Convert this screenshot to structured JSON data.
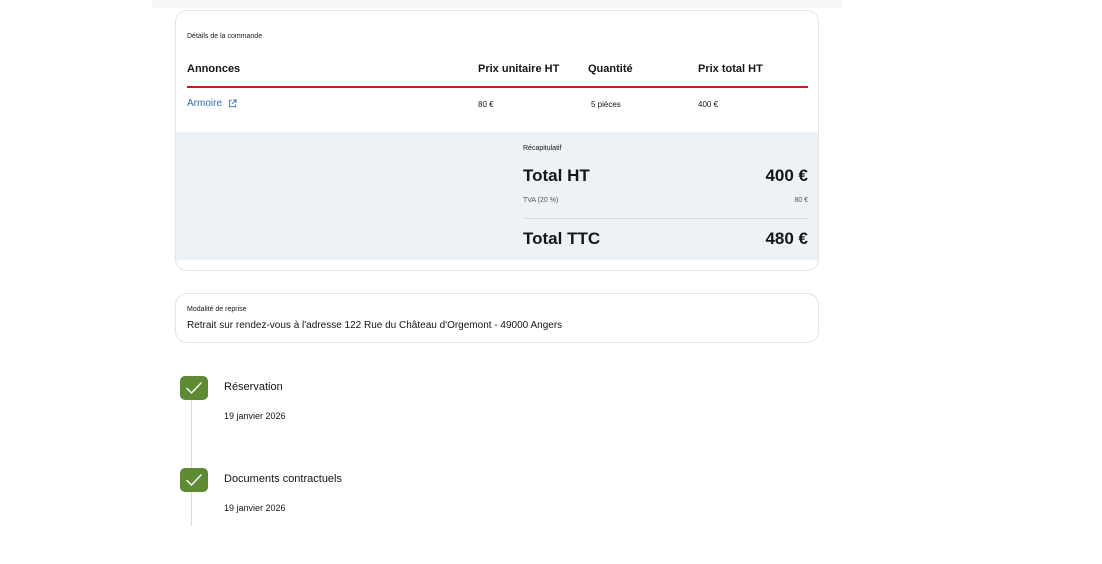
{
  "order": {
    "section_title": "Détails de la commande",
    "columns": [
      "Annonces",
      "Prix unitaire HT",
      "Quantité",
      "Prix total HT"
    ],
    "rows": [
      {
        "annonce": "Armoire",
        "unit_price": "80 €",
        "quantity": "5 pièces",
        "total": "400 €"
      }
    ],
    "summary": {
      "label": "Récapitulatif",
      "total_ht_label": "Total HT",
      "total_ht_value": "400 €",
      "tva_label": "TVA (20 %)",
      "tva_value": "80 €",
      "total_ttc_label": "Total TTC",
      "total_ttc_value": "480 €"
    }
  },
  "pickup": {
    "label": "Modalité de reprise",
    "text": "Retrait sur rendez-vous à l'adresse 122 Rue du Château d'Orgemont - 49000 Angers"
  },
  "timeline": [
    {
      "title": "Réservation",
      "date": "19 janvier 2026",
      "icon": "check-icon"
    },
    {
      "title": "Documents contractuels",
      "date": "19 janvier 2026",
      "icon": "check-icon"
    }
  ],
  "colors": {
    "accent_red": "#c9191e",
    "link_blue": "#2a6eb8",
    "summary_bg": "#edf2f7",
    "check_green": "#5f8a34"
  }
}
